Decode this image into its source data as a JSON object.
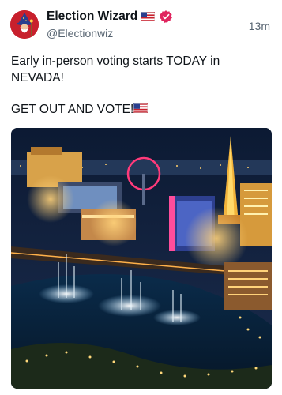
{
  "post": {
    "author": {
      "display_name": "Election Wizard",
      "handle": "@Electionwiz",
      "verified": true,
      "name_flag_icon": "us-flag-icon",
      "badge_icon": "verified-badge-icon",
      "avatar_icon": "wizard-avatar-icon"
    },
    "timestamp": "13m",
    "text_lines": [
      "Early in-person voting starts TODAY in",
      "NEVADA!",
      "GET OUT AND VOTE!"
    ],
    "text_flag_icon": "us-flag-icon",
    "image": {
      "icon": "las-vegas-strip-photo"
    },
    "colors": {
      "badge": "#e0245e",
      "avatar_bg": "#c8202d",
      "secondary_text": "#566370"
    }
  }
}
